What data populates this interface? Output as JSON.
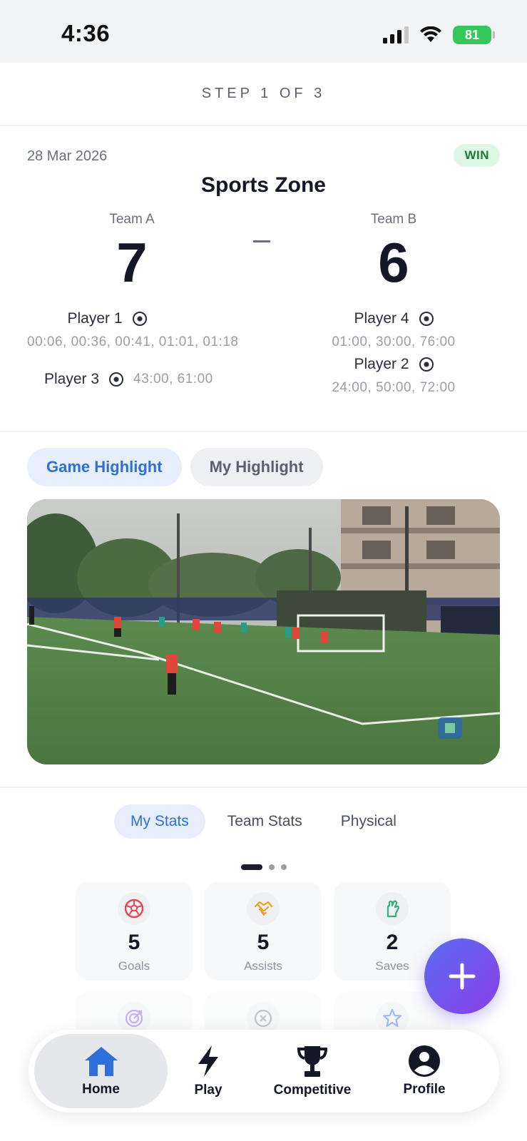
{
  "status_bar": {
    "time": "4:36",
    "battery": "81"
  },
  "header": {
    "step": "STEP 1 OF 3"
  },
  "match": {
    "date": "28 Mar 2026",
    "result_badge": "WIN",
    "venue": "Sports Zone",
    "team_a": {
      "name": "Team A",
      "score": "7",
      "scorers": [
        {
          "name": "Player 1",
          "times": "00:06, 00:36, 00:41, 01:01, 01:18"
        },
        {
          "name": "Player 3",
          "times": "43:00, 61:00"
        }
      ]
    },
    "team_b": {
      "name": "Team B",
      "score": "6",
      "scorers": [
        {
          "name": "Player 4",
          "times": "01:00, 30:00, 76:00"
        },
        {
          "name": "Player 2",
          "times": "24:00, 50:00, 72:00"
        }
      ]
    }
  },
  "highlights": {
    "tabs": [
      {
        "label": "Game Highlight",
        "active": true
      },
      {
        "label": "My Highlight",
        "active": false
      }
    ]
  },
  "stats": {
    "tabs": [
      {
        "label": "My Stats",
        "active": true
      },
      {
        "label": "Team Stats",
        "active": false
      },
      {
        "label": "Physical",
        "active": false
      }
    ],
    "page_indicator": {
      "pages": 3,
      "current": 1
    },
    "cards": [
      {
        "value": "5",
        "label": "Goals",
        "icon": "soccer-ball-icon",
        "color": "#e5484d"
      },
      {
        "value": "5",
        "label": "Assists",
        "icon": "handshake-icon",
        "color": "#f0a020"
      },
      {
        "value": "2",
        "label": "Saves",
        "icon": "goalkeeper-glove-icon",
        "color": "#2fb37a"
      },
      {
        "value": "",
        "label": "",
        "icon": "target-icon",
        "color": "#9a6cf0"
      },
      {
        "value": "",
        "label": "",
        "icon": "cross-circle-icon",
        "color": "#8e93a0"
      },
      {
        "value": "",
        "label": "",
        "icon": "star-icon",
        "color": "#4f86f0"
      }
    ]
  },
  "nav": {
    "items": [
      {
        "label": "Home",
        "icon": "home-icon",
        "active": true
      },
      {
        "label": "Play",
        "icon": "lightning-icon",
        "active": false
      },
      {
        "label": "Competitive",
        "icon": "trophy-icon",
        "active": false
      },
      {
        "label": "Profile",
        "icon": "profile-icon",
        "active": false
      }
    ]
  },
  "colors": {
    "accent": "#2f6fd9",
    "win_green": "#1c7a3a",
    "fab_gradient_start": "#5b6cf3",
    "fab_gradient_end": "#8a3fe6"
  }
}
